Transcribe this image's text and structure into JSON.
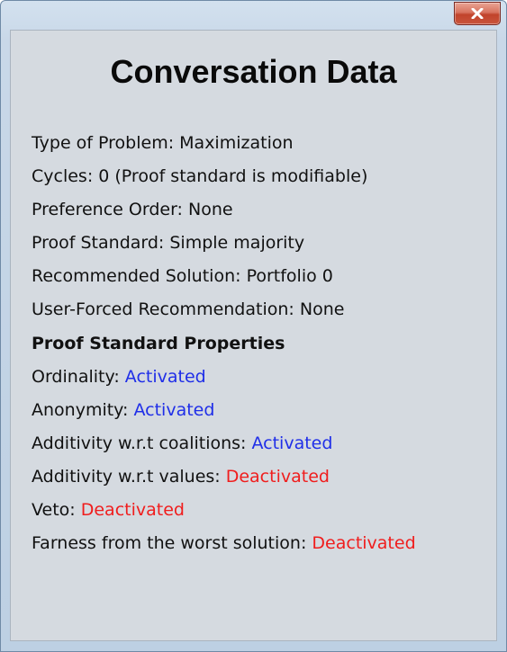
{
  "window": {
    "close_button_label": "x"
  },
  "title": "Conversation Data",
  "rows": [
    {
      "label": "Type of Problem: ",
      "value": "Maximization"
    },
    {
      "label": "Cycles: ",
      "value": "0 (Proof standard is modifiable)"
    },
    {
      "label": "Preference Order: ",
      "value": "None"
    },
    {
      "label": "Proof Standard: ",
      "value": "Simple majority"
    },
    {
      "label": "Recommended Solution: ",
      "value": "Portfolio 0"
    },
    {
      "label": "User-Forced Recommendation: ",
      "value": "None"
    }
  ],
  "properties_heading": "Proof Standard Properties",
  "properties": [
    {
      "label": "Ordinality: ",
      "value": "Activated",
      "status": "on"
    },
    {
      "label": "Anonymity: ",
      "value": "Activated",
      "status": "on"
    },
    {
      "label": "Additivity w.r.t coalitions: ",
      "value": "Activated",
      "status": "on"
    },
    {
      "label": "Additivity w.r.t values: ",
      "value": "Deactivated",
      "status": "off"
    },
    {
      "label": "Veto: ",
      "value": "Deactivated",
      "status": "off"
    },
    {
      "label": "Farness from the worst solution: ",
      "value": "Deactivated",
      "status": "off"
    }
  ],
  "colors": {
    "activated": "#1f2ee8",
    "deactivated": "#f01d1d"
  },
  "icons": {
    "close": "close-icon"
  }
}
